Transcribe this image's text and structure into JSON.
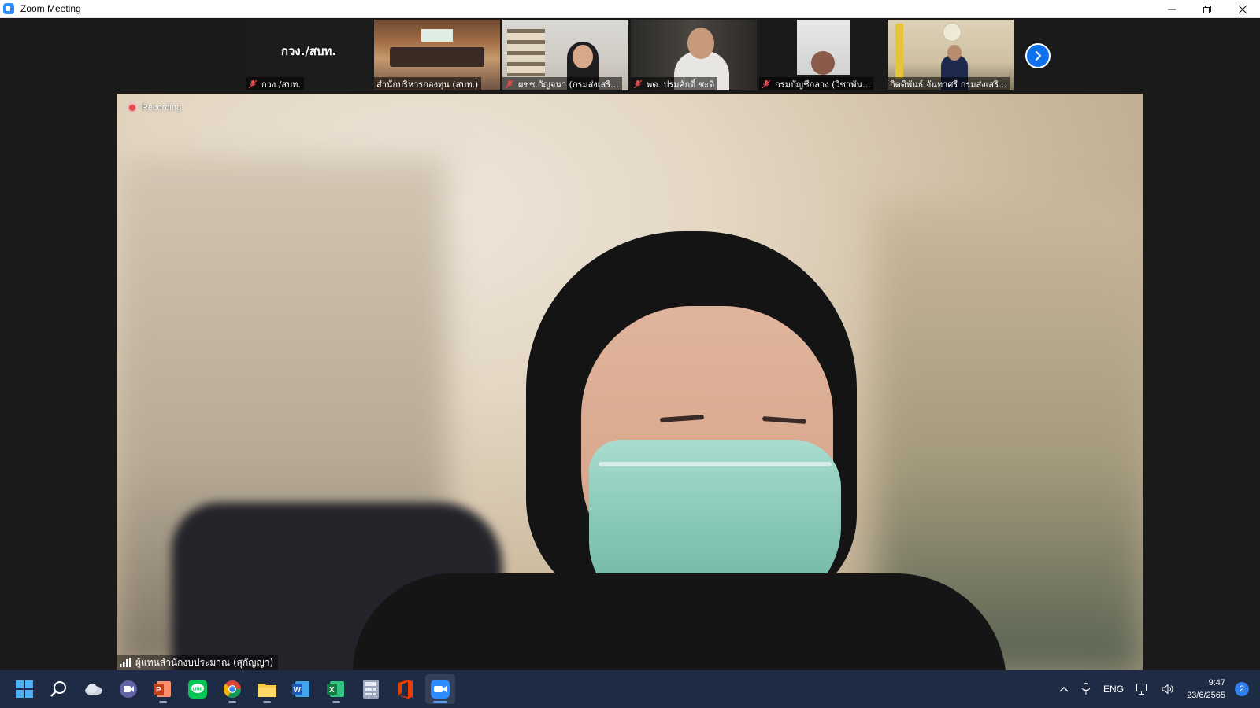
{
  "window": {
    "title": "Zoom Meeting",
    "controls": [
      "minimize",
      "restore",
      "close"
    ]
  },
  "thumbnails": [
    {
      "big_name": "กวง./สบท.",
      "label": "กวง./สบท.",
      "muted": true,
      "icon": "mic-muted-icon"
    },
    {
      "label": "สำนักบริหารกองทุน (สบท.)",
      "muted": false
    },
    {
      "label": "ผชช.กัญจนา (กรมส่งเสริ...",
      "muted": true,
      "icon": "mic-muted-icon"
    },
    {
      "label": "พต. ปรมศักดิ์ ชะติ",
      "muted": true,
      "icon": "mic-muted-icon"
    },
    {
      "label": "กรมบัญชีกลาง (วิชาพัน...",
      "muted": true,
      "icon": "mic-muted-icon"
    },
    {
      "label": "กิตติพันธ์ จันทาศรี กรมส่งเสริ...",
      "muted": false
    }
  ],
  "next_button_icon": "chevron-right-icon",
  "main_video": {
    "recording_label": "Recording",
    "speaker_name": "ผู้แทนสำนักงบประมาณ (สุกัญญา)",
    "signal_icon": "signal-bars-icon"
  },
  "taskbar": {
    "apps": [
      "start-icon",
      "search-icon",
      "onedrive-icon",
      "teams-chat-icon",
      "powerpoint-icon",
      "line-icon",
      "chrome-icon",
      "file-explorer-icon",
      "word-icon",
      "excel-icon",
      "calculator-icon",
      "office-icon",
      "zoom-icon"
    ],
    "language": "ENG",
    "time": "9:47",
    "date": "23/6/2565",
    "notification_count": "2"
  },
  "colors": {
    "accent_blue": "#0e72ed",
    "recording_red": "#e5484d",
    "taskbar_bg": "#1e2b45"
  }
}
